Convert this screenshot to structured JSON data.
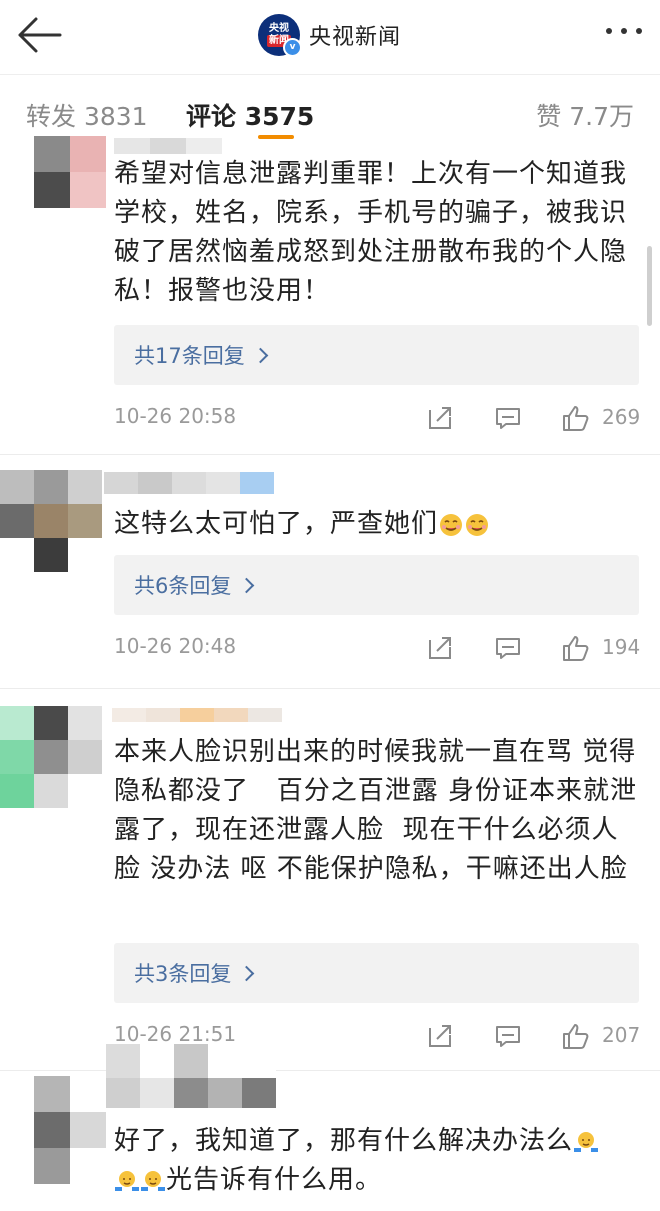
{
  "nav": {
    "back_icon": "arrow-left-icon",
    "logo_line1": "央视",
    "logo_line2": "新闻",
    "account_name": "央视新闻",
    "more_icon": "more-dots-icon"
  },
  "tabs": {
    "repost": "转发 3831",
    "comments": "评论 3575",
    "likes": "赞 7.7万",
    "accent_color": "#f28c00"
  },
  "comments": [
    {
      "text": "希望对信息泄露判重罪！上次有一个知道我学校，姓名，院系，手机号的骗子，被我识破了居然恼羞成怒到处注册散布我的个人隐私！报警也没用！",
      "replies": "共17条回复",
      "time": "10-26 20:58",
      "likes": "269"
    },
    {
      "text": "这特么太可怕了，严查她们",
      "emoji": [
        "drool-face-emoji",
        "drool-face-emoji"
      ],
      "replies": "共6条回复",
      "time": "10-26 20:48",
      "likes": "194"
    },
    {
      "text": "本来人脸识别出来的时候我就一直在骂 觉得隐私都没了   百分之百泄露 身份证本来就泄露了，现在还泄露人脸  现在干什么必须人脸 没办法 呕 不能保护隐私，干嘛还出人脸",
      "replies": "共3条回复",
      "time": "10-26 21:51",
      "likes": "207"
    },
    {
      "text_line1": "好了，我知道了，那有什么解决办法么",
      "text_line2": "光告诉有什么用。",
      "emoji": [
        "shrug-emoji",
        "shrug-emoji",
        "shrug-emoji"
      ]
    }
  ],
  "colors": {
    "link": "#4a6ea0",
    "meta": "#9a9a9a",
    "reply_bg": "#f2f2f2"
  }
}
